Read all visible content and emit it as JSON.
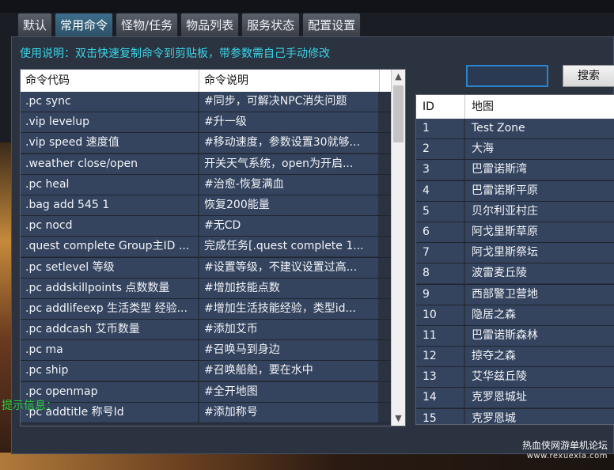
{
  "tabs": [
    {
      "label": "默认",
      "active": false
    },
    {
      "label": "常用命令",
      "active": true
    },
    {
      "label": "怪物/任务",
      "active": false
    },
    {
      "label": "物品列表",
      "active": false
    },
    {
      "label": "服务状态",
      "active": false
    },
    {
      "label": "配置设置",
      "active": false
    }
  ],
  "hint_text": "使用说明：双击快速复制命令到剪贴板，带参数需自己手动修改",
  "command_table": {
    "headers": [
      "命令代码",
      "命令说明"
    ],
    "rows": [
      {
        "code": ".pc sync",
        "desc": "#同步，可解决NPC消失问题"
      },
      {
        "code": ".vip levelup",
        "desc": "#升一级"
      },
      {
        "code": ".vip speed 速度值",
        "desc": "#移动速度，参数设置30就够..."
      },
      {
        "code": ".weather close/open",
        "desc": "开关天气系统，open为开启..."
      },
      {
        "code": ".pc heal",
        "desc": "#治愈-恢复满血"
      },
      {
        "code": ".bag add 545 1",
        "desc": "恢复200能量"
      },
      {
        "code": ".pc nocd",
        "desc": "#无CD"
      },
      {
        "code": ".quest complete Group主ID ...",
        "desc": "完成任务[.quest complete 1..."
      },
      {
        "code": ".pc setlevel 等级",
        "desc": "#设置等级，不建议设置过高..."
      },
      {
        "code": ".pc addskillpoints 点数数量",
        "desc": "#增加技能点数"
      },
      {
        "code": ".pc addlifeexp 生活类型 经验...",
        "desc": "#增加生活技能经验，类型id..."
      },
      {
        "code": ".pc addcash 艾币数量",
        "desc": "#添加艾币"
      },
      {
        "code": ".pc ma",
        "desc": "#召唤马到身边"
      },
      {
        "code": ".pc ship",
        "desc": "#召唤船舶，要在水中"
      },
      {
        "code": ".pc openmap",
        "desc": "#全开地图"
      },
      {
        "code": ".pc addtitle 称号Id",
        "desc": "#添加称号"
      }
    ]
  },
  "search": {
    "input_value": "",
    "button_label": "搜索"
  },
  "map_table": {
    "headers": [
      "ID",
      "地图"
    ],
    "rows": [
      {
        "id": "1",
        "name": "Test Zone"
      },
      {
        "id": "2",
        "name": "大海"
      },
      {
        "id": "3",
        "name": "巴雷诺斯湾"
      },
      {
        "id": "4",
        "name": "巴雷诺斯平原"
      },
      {
        "id": "5",
        "name": "贝尔利亚村庄"
      },
      {
        "id": "6",
        "name": "阿戈里斯草原"
      },
      {
        "id": "7",
        "name": "阿戈里斯祭坛"
      },
      {
        "id": "8",
        "name": "波雷麦丘陵"
      },
      {
        "id": "9",
        "name": "西部警卫营地"
      },
      {
        "id": "10",
        "name": "隐居之森"
      },
      {
        "id": "11",
        "name": "巴雷诺斯森林"
      },
      {
        "id": "12",
        "name": "掠夺之森"
      },
      {
        "id": "13",
        "name": "艾华兹丘陵"
      },
      {
        "id": "14",
        "name": "克罗恩城址"
      },
      {
        "id": "15",
        "name": "克罗恩城"
      }
    ]
  },
  "info_label": "提示信息：",
  "watermark": {
    "line1": "热血侠网游单机论坛",
    "line2": "www.rexuexia.com"
  },
  "colors": {
    "hint": "#38d6e8",
    "info": "#2ecc40",
    "row_bg": "#34435e",
    "tab_active": "#2c5066"
  }
}
